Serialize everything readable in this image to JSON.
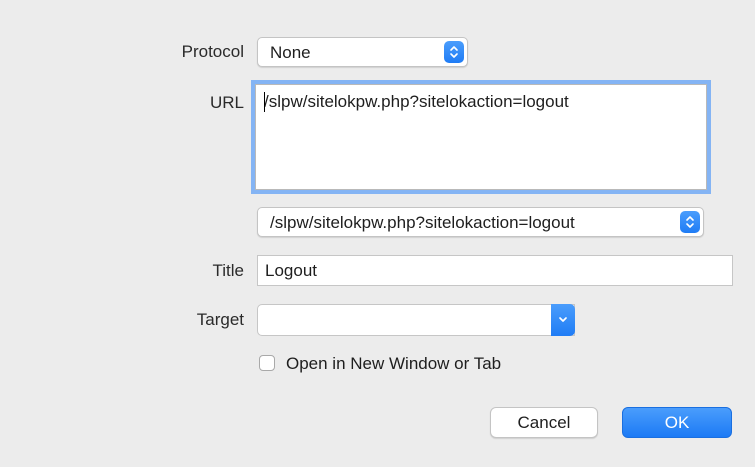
{
  "protocol": {
    "label": "Protocol",
    "selected": "None"
  },
  "url": {
    "label": "URL",
    "value": "/slpw/sitelokpw.php?sitelokaction=logout",
    "history_selected": "/slpw/sitelokpw.php?sitelokaction=logout"
  },
  "title": {
    "label": "Title",
    "value": "Logout"
  },
  "target": {
    "label": "Target",
    "value": ""
  },
  "new_window": {
    "label": "Open in New Window or Tab",
    "checked": false
  },
  "buttons": {
    "cancel": "Cancel",
    "ok": "OK"
  },
  "colors": {
    "accent": "#1f7cf5",
    "focus_ring": "#84b4f4",
    "background": "#ececec"
  },
  "icons": {
    "popup_stepper": "up-down-chevron-icon",
    "combo_arrow": "chevron-down-icon"
  }
}
